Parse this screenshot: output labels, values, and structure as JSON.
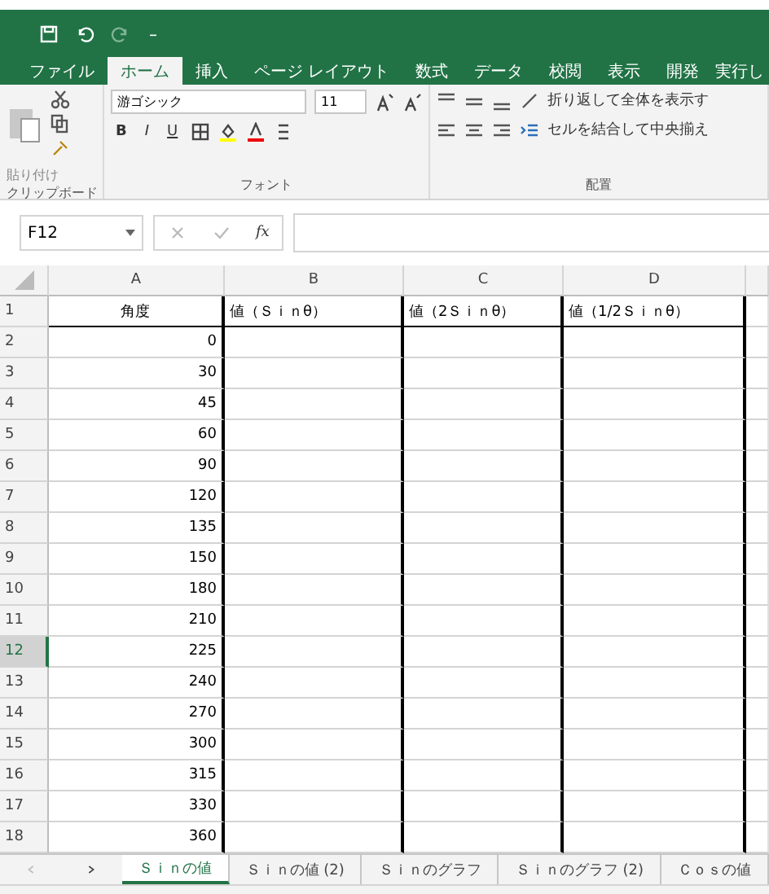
{
  "ribbon_tabs": [
    {
      "label": "ファイル",
      "selected": false
    },
    {
      "label": "ホーム",
      "selected": true
    },
    {
      "label": "挿入",
      "selected": false
    },
    {
      "label": "ページ レイアウト",
      "selected": false
    },
    {
      "label": "数式",
      "selected": false
    },
    {
      "label": "データ",
      "selected": false
    },
    {
      "label": "校閲",
      "selected": false
    },
    {
      "label": "表示",
      "selected": false
    },
    {
      "label": "開発",
      "selected": false
    }
  ],
  "tell_me": "実行し",
  "clipboard": {
    "paste": "貼り付け",
    "label": "クリップボード"
  },
  "font": {
    "name": "游ゴシック",
    "size": "11",
    "styles": [
      "B",
      "I",
      "U"
    ],
    "label": "フォント"
  },
  "alignment": {
    "wrap": "折り返して全体を表示す",
    "merge": "セルを結合して中央揃え",
    "label": "配置"
  },
  "formula_bar": {
    "name_box": "F12",
    "value_icon": "fx"
  },
  "columns": [
    "A",
    "B",
    "C",
    "D"
  ],
  "header_row": {
    "number": "1",
    "cells": [
      "角度",
      "値（Ｓｉｎθ）",
      "値（2Ｓｉｎθ）",
      "値（1/2Ｓｉｎθ）"
    ]
  },
  "rows": [
    {
      "number": "2",
      "angle": "0",
      "selected": false
    },
    {
      "number": "3",
      "angle": "30",
      "selected": false
    },
    {
      "number": "4",
      "angle": "45",
      "selected": false
    },
    {
      "number": "5",
      "angle": "60",
      "selected": false
    },
    {
      "number": "6",
      "angle": "90",
      "selected": false
    },
    {
      "number": "7",
      "angle": "120",
      "selected": false
    },
    {
      "number": "8",
      "angle": "135",
      "selected": false
    },
    {
      "number": "9",
      "angle": "150",
      "selected": false
    },
    {
      "number": "10",
      "angle": "180",
      "selected": false
    },
    {
      "number": "11",
      "angle": "210",
      "selected": false
    },
    {
      "number": "12",
      "angle": "225",
      "selected": true
    },
    {
      "number": "13",
      "angle": "240",
      "selected": false
    },
    {
      "number": "14",
      "angle": "270",
      "selected": false
    },
    {
      "number": "15",
      "angle": "300",
      "selected": false
    },
    {
      "number": "16",
      "angle": "315",
      "selected": false
    },
    {
      "number": "17",
      "angle": "330",
      "selected": false
    },
    {
      "number": "18",
      "angle": "360",
      "selected": false
    }
  ],
  "sheet_tabs": [
    {
      "label": "Ｓｉｎの値",
      "selected": true
    },
    {
      "label": "Ｓｉｎの値 (2)",
      "selected": false
    },
    {
      "label": "Ｓｉｎのグラフ",
      "selected": false
    },
    {
      "label": "Ｓｉｎのグラフ (2)",
      "selected": false
    },
    {
      "label": "Ｃｏｓの値",
      "selected": false
    }
  ]
}
